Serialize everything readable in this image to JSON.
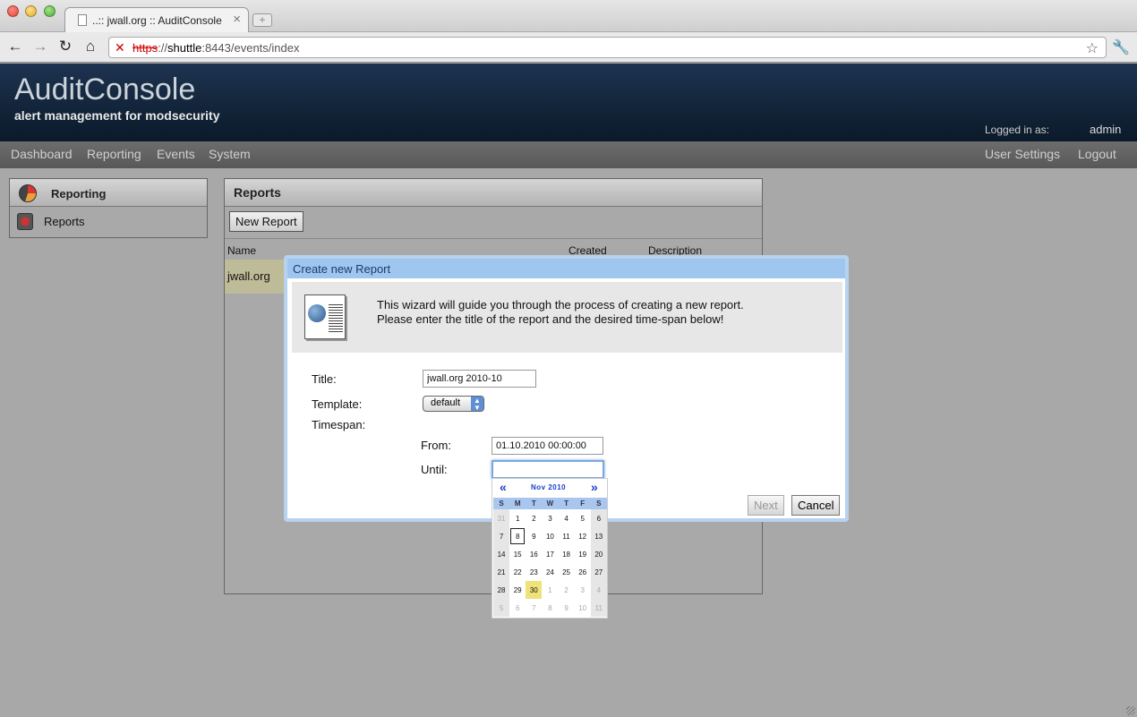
{
  "browser": {
    "tab_title": "..:: jwall.org :: AuditConsole",
    "url_scheme": "https",
    "url_sep": "://",
    "url_host": "shuttle",
    "url_rest": ":8443/events/index"
  },
  "header": {
    "title": "AuditConsole",
    "subtitle": "alert management for modsecurity",
    "logged_in_label": "Logged in as:",
    "user": "admin"
  },
  "menu": {
    "left": [
      "Dashboard",
      "Reporting",
      "Events",
      "System"
    ],
    "right": [
      "User Settings",
      "Logout"
    ]
  },
  "sidebar": {
    "title": "Reporting",
    "items": [
      {
        "label": "Reports"
      }
    ]
  },
  "reports": {
    "title": "Reports",
    "new_button": "New Report",
    "columns": [
      "Name",
      "Created",
      "Description"
    ],
    "rows": [
      {
        "name": "jwall.org"
      }
    ]
  },
  "dialog": {
    "title": "Create new Report",
    "intro_line1": "This wizard will guide you through the process of creating a new report.",
    "intro_line2": "Please enter the title of the report and the desired time-span below!",
    "title_label": "Title:",
    "title_value": "jwall.org 2010-10",
    "template_label": "Template:",
    "template_value": "default",
    "timespan_label": "Timespan:",
    "from_label": "From:",
    "from_value": "01.10.2010 00:00:00",
    "until_label": "Until:",
    "until_value": "",
    "next_button": "Next",
    "cancel_button": "Cancel"
  },
  "calendar": {
    "prev": "«",
    "next": "»",
    "month_title": "Nov 2010",
    "weekdays": [
      "S",
      "M",
      "T",
      "W",
      "T",
      "F",
      "S"
    ],
    "weeks": [
      [
        "31",
        "1",
        "2",
        "3",
        "4",
        "5",
        "6"
      ],
      [
        "7",
        "8",
        "9",
        "10",
        "11",
        "12",
        "13"
      ],
      [
        "14",
        "15",
        "16",
        "17",
        "18",
        "19",
        "20"
      ],
      [
        "21",
        "22",
        "23",
        "24",
        "25",
        "26",
        "27"
      ],
      [
        "28",
        "29",
        "30",
        "1",
        "2",
        "3",
        "4"
      ],
      [
        "5",
        "6",
        "7",
        "8",
        "9",
        "10",
        "11"
      ]
    ],
    "today": "8",
    "selected": "30"
  }
}
